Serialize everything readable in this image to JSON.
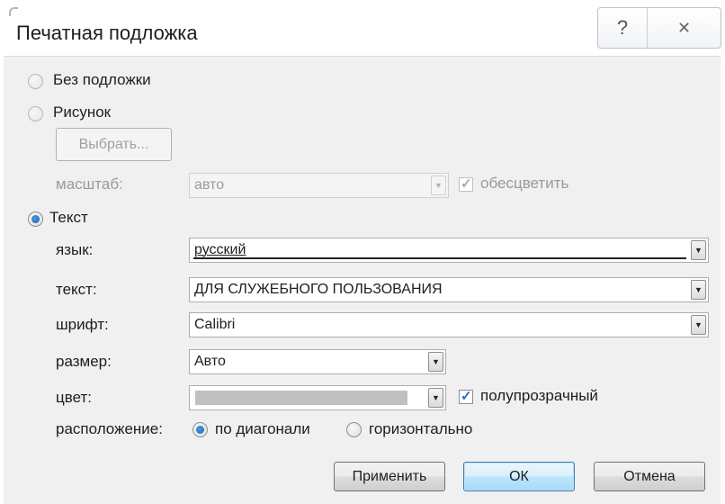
{
  "dialog": {
    "title": "Печатная подложка",
    "help_glyph": "?",
    "close_glyph": "✕"
  },
  "options": {
    "no_watermark": "Без подложки",
    "picture": "Рисунок",
    "text": "Текст",
    "selected": "text"
  },
  "picture_group": {
    "select_button": "Выбрать...",
    "scale_label": "масштаб:",
    "scale_value": "авто",
    "washout_label": "обесцветить",
    "washout_checked": true
  },
  "text_group": {
    "language_label": "язык:",
    "language_value": "русский",
    "text_label": "текст:",
    "text_value": "ДЛЯ СЛУЖЕБНОГО ПОЛЬЗОВАНИЯ",
    "font_label": "шрифт:",
    "font_value": "Calibri",
    "size_label": "размер:",
    "size_value": "Авто",
    "color_label": "цвет:",
    "color_value": "#c0c0c0",
    "semitransparent_label": "полупрозрачный",
    "semitransparent_checked": true,
    "layout_label": "расположение:",
    "diagonal_label": "по диагонали",
    "horizontal_label": "горизонтально",
    "layout_selected": "diagonal"
  },
  "buttons": {
    "apply": "Применить",
    "ok": "ОК",
    "cancel": "Отмена"
  },
  "icons": {
    "dropdown": "triangle-down",
    "help": "question-mark",
    "close": "x-mark"
  }
}
